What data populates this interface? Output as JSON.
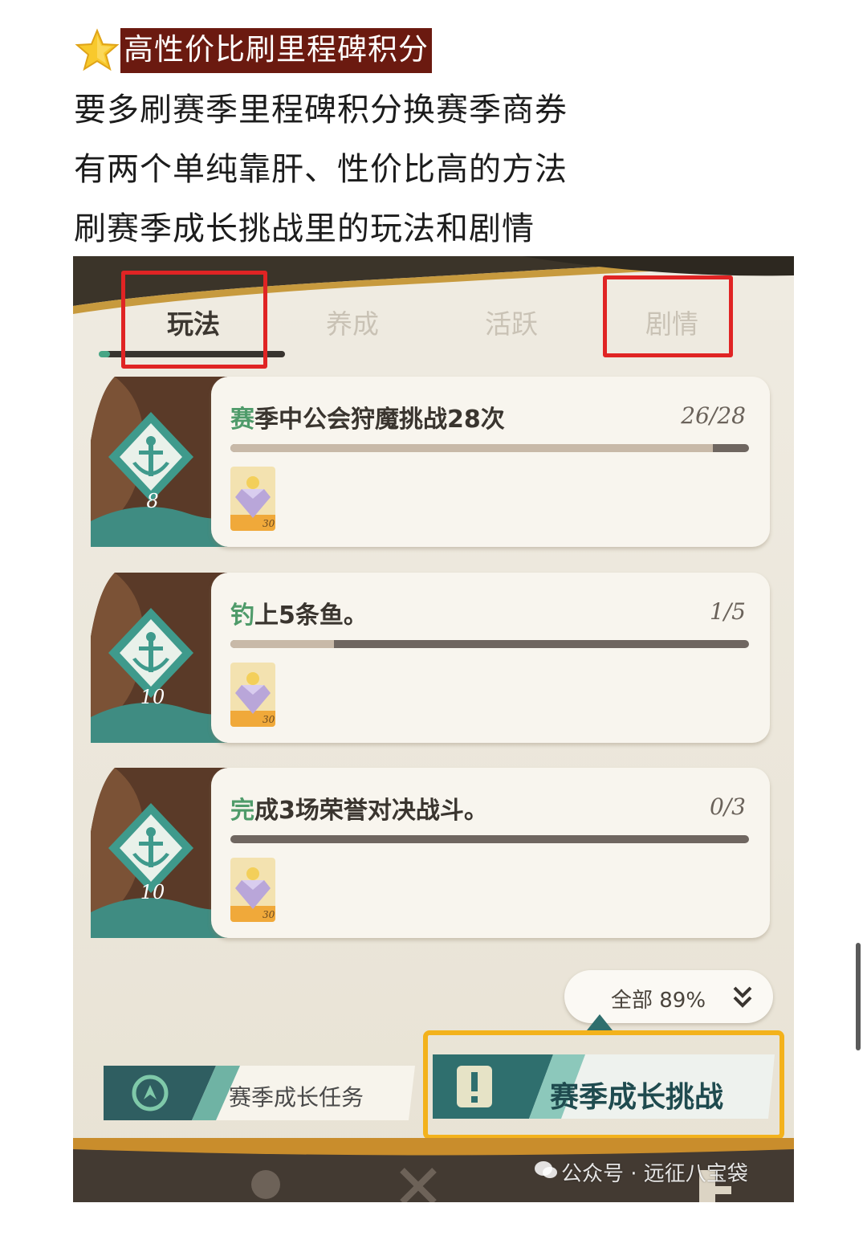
{
  "article": {
    "heading": "高性价比刷里程碑积分",
    "lines": [
      "要多刷赛季里程碑积分换赛季商券",
      "有两个单纯靠肝、性价比高的方法",
      "刷赛季成长挑战里的玩法和剧情"
    ],
    "star_icon": "star-icon"
  },
  "game": {
    "tabs": [
      {
        "label": "玩法",
        "active": true,
        "highlighted": true
      },
      {
        "label": "养成",
        "active": false,
        "highlighted": false
      },
      {
        "label": "活跃",
        "active": false,
        "highlighted": false
      },
      {
        "label": "剧情",
        "active": false,
        "highlighted": true
      }
    ],
    "quests": [
      {
        "title_first": "赛",
        "title_rest": "季中公会狩魔挑战28次",
        "progress": "26/28",
        "progress_fraction": 0.93,
        "level": "8",
        "reward_count": "30",
        "reward_icon": "diamond-icon"
      },
      {
        "title_first": "钓",
        "title_rest": "上5条鱼。",
        "progress": "1/5",
        "progress_fraction": 0.2,
        "level": "10",
        "reward_count": "30",
        "reward_icon": "diamond-icon"
      },
      {
        "title_first": "完",
        "title_rest": "成3场荣誉对决战斗。",
        "progress": "0/3",
        "progress_fraction": 0.0,
        "level": "10",
        "reward_count": "30",
        "reward_icon": "diamond-icon"
      }
    ],
    "filter": {
      "label": "全部 89%",
      "icon": "chevrons-down-icon"
    },
    "buttons": {
      "growth_tasks": "赛季成长任务",
      "growth_challenge": "赛季成长挑战"
    },
    "watermark": "公众号 · 远征八宝袋",
    "colors": {
      "highlight_red": "#e02424",
      "highlight_yellow": "#f3b21c",
      "accent_green": "#4f9b6a",
      "teal": "#2f8a86"
    }
  }
}
